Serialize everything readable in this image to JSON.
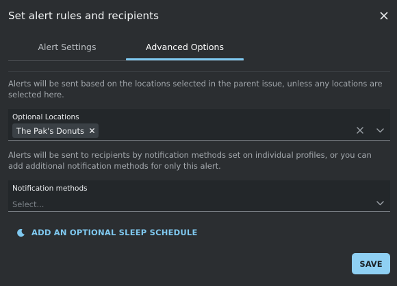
{
  "dialog": {
    "title": "Set alert rules and recipients"
  },
  "tabs": [
    {
      "label": "Alert Settings",
      "active": false
    },
    {
      "label": "Advanced Options",
      "active": true
    }
  ],
  "locations": {
    "description": "Alerts will be sent based on the locations selected in the parent issue, unless any locations are selected here.",
    "label": "Optional Locations",
    "selected": [
      "The Pak's Donuts"
    ]
  },
  "notifications": {
    "description": "Alerts will be sent to recipients by notification methods set on individual profiles, or you can add additional notification methods for only this alert.",
    "label": "Notification methods",
    "placeholder": "Select..."
  },
  "sleep_schedule": {
    "label": "ADD AN OPTIONAL SLEEP SCHEDULE"
  },
  "actions": {
    "save_label": "SAVE"
  },
  "colors": {
    "accent": "#7fc8ef",
    "button": "#8fd0f3",
    "background": "#2b2e31",
    "field": "#23272a"
  },
  "icons": {
    "close": "close-icon",
    "clear": "clear-icon",
    "dropdown": "chevron-down-icon",
    "sleep": "moon-icon"
  }
}
